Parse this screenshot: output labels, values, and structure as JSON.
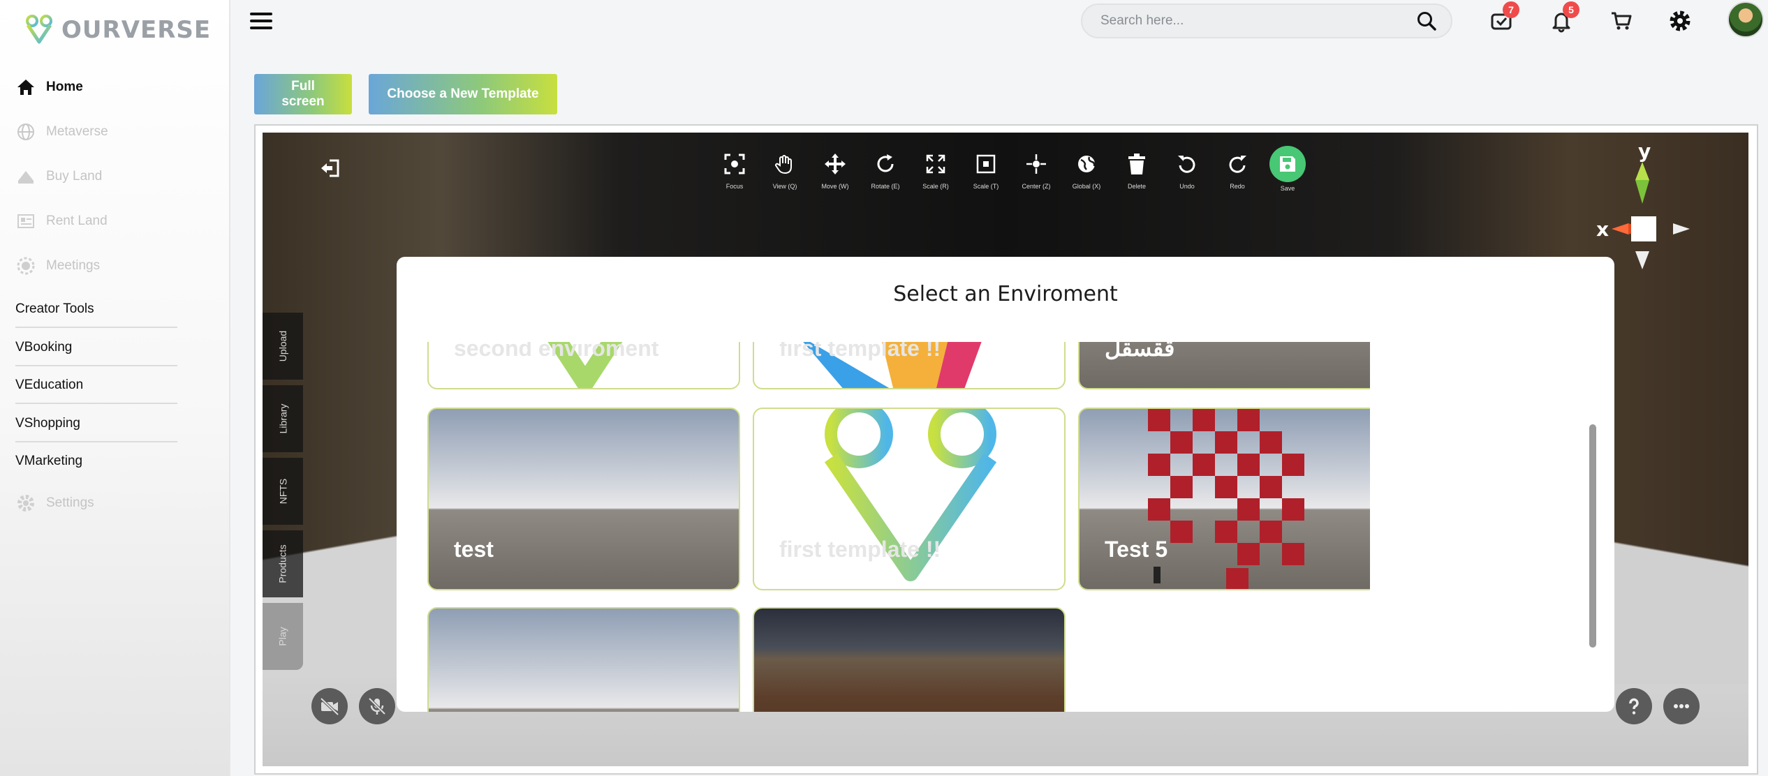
{
  "brand": {
    "name_part1": "OUR",
    "name_part2": "VERSE"
  },
  "sidebar": {
    "items": [
      {
        "label": "Home",
        "icon": "home-icon",
        "state": "active"
      },
      {
        "label": "Metaverse",
        "icon": "globe-icon",
        "state": "disabled"
      },
      {
        "label": "Buy Land",
        "icon": "land-icon",
        "state": "disabled"
      },
      {
        "label": "Rent Land",
        "icon": "rent-icon",
        "state": "disabled"
      },
      {
        "label": "Meetings",
        "icon": "meetings-icon",
        "state": "disabled"
      }
    ],
    "tools": [
      "Creator Tools",
      "VBooking",
      "VEducation",
      "VShopping",
      "VMarketing"
    ],
    "settings_label": "Settings"
  },
  "header": {
    "search_placeholder": "Search here...",
    "messages_count": "7",
    "notifications_count": "5"
  },
  "actions": {
    "fullscreen_label": "Full screen",
    "template_label": "Choose a New Template"
  },
  "editor": {
    "toolbar": [
      {
        "label": "Focus",
        "icon": "focus-icon"
      },
      {
        "label": "View (Q)",
        "icon": "hand-icon"
      },
      {
        "label": "Move (W)",
        "icon": "move-icon"
      },
      {
        "label": "Rotate (E)",
        "icon": "rotate-icon"
      },
      {
        "label": "Scale (R)",
        "icon": "scale-icon"
      },
      {
        "label": "Scale (T)",
        "icon": "scale-box-icon"
      },
      {
        "label": "Center (Z)",
        "icon": "center-icon"
      },
      {
        "label": "Global (X)",
        "icon": "global-icon"
      },
      {
        "label": "Delete",
        "icon": "trash-icon"
      },
      {
        "label": "Undo",
        "icon": "undo-icon"
      },
      {
        "label": "Redo",
        "icon": "redo-icon"
      },
      {
        "label": "Save",
        "icon": "save-icon"
      }
    ],
    "gizmo": {
      "x_label": "x",
      "y_label": "y"
    },
    "side_tabs": [
      "Upload",
      "Library",
      "NFTS",
      "Products",
      "Play"
    ]
  },
  "modal": {
    "title": "Select an Enviroment",
    "cards": [
      {
        "label": "second enviroment",
        "style": "white"
      },
      {
        "label": "first template !!",
        "style": "white"
      },
      {
        "label": "ققسقل",
        "style": "sky"
      },
      {
        "label": "test",
        "style": "sky"
      },
      {
        "label": "first template !!",
        "style": "white"
      },
      {
        "label": "Test 5",
        "style": "sky"
      },
      {
        "label": "",
        "style": "sky"
      },
      {
        "label": "",
        "style": "dirt"
      }
    ]
  },
  "colors": {
    "accent_gradient_start": "#6aa6d8",
    "accent_gradient_end": "#c8df3e",
    "badge": "#ef4b4b",
    "save": "#48c774"
  }
}
